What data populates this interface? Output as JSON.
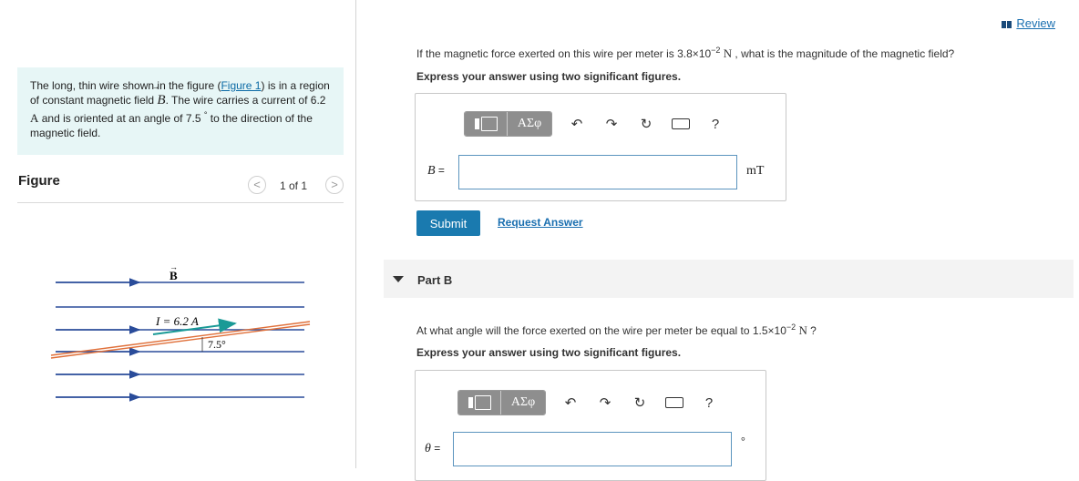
{
  "problem": {
    "text_1": "The long, thin wire shown in the figure (",
    "figure_link": "Figure 1",
    "text_2": ") is in a region of constant magnetic field ",
    "field_symbol": "B",
    "text_3": ". The wire carries a current of 6.2 ",
    "current_unit": "A",
    "text_4": " and is oriented at an angle of 7.5 ",
    "degree": "°",
    "text_5": " to the direction of the magnetic field."
  },
  "figure_panel": {
    "title": "Figure",
    "prev": "<",
    "counter": "1 of 1",
    "next": ">",
    "field_label": "B",
    "current_label": "I = 6.2 A",
    "angle_label": "7.5°"
  },
  "review": "Review",
  "part_a": {
    "question_1": "If the magnetic force exerted on this wire per meter is 3.8×10",
    "question_exp": "−2",
    "question_unit": " N",
    "question_2": " , what is the magnitude of the magnetic field?",
    "instruction": "Express your answer using two significant figures.",
    "var": "B",
    "eq": " =",
    "input_value": "",
    "unit": "mT",
    "submit": "Submit",
    "request": "Request Answer"
  },
  "part_b": {
    "title": "Part B",
    "question_1": "At what angle will the force exerted on the wire per meter be equal to 1.5×10",
    "question_exp": "−2",
    "question_unit": " N",
    "question_2": " ?",
    "instruction": "Express your answer using two significant figures.",
    "var": "θ",
    "eq": " =",
    "input_value": "",
    "unit": "°"
  },
  "toolbar": {
    "greek": "ΑΣφ",
    "help": "?"
  },
  "colors": {
    "accent": "#1a7aaf",
    "link": "#1a6fb0",
    "problem_bg": "#e7f6f6",
    "field_lines": "#2a4c9a",
    "wire": "#e0703a",
    "current_arrow": "#1a9a96"
  }
}
